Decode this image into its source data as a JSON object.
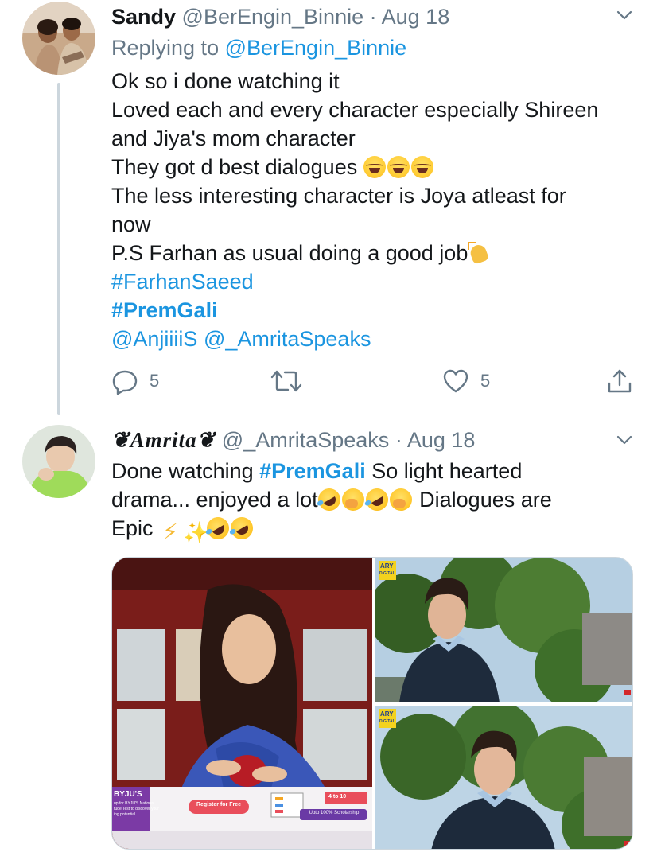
{
  "tweets": [
    {
      "name": "Sandy",
      "handle": "@BerEngin_Binnie",
      "separator": "·",
      "date": "Aug 18",
      "replying_prefix": "Replying to",
      "replying_handle": "@BerEngin_Binnie",
      "lines": {
        "l1": "Ok so i done watching it",
        "l2": "Loved each and every character especially Shireen",
        "l3": "and Jiya's mom character",
        "l4": "They got d best dialogues",
        "l5": "The less interesting character is Joya atleast for",
        "l6": "now",
        "l7": "P.S Farhan as usual doing a good job",
        "l8": "#FarhanSaeed",
        "l9": "#PremGali",
        "l10a": "@AnjiiiiS",
        "l10b": "@_AmritaSpeaks"
      },
      "reply_count": "5",
      "like_count": "5"
    },
    {
      "name": "❦Amrita❦",
      "handle": "@_AmritaSpeaks",
      "separator": "·",
      "date": "Aug 18",
      "text": {
        "a1": "Done watching ",
        "a2": "#PremGali",
        "a3": " So light hearted",
        "a4": "drama... enjoyed a lot",
        "a5": " Dialogues are",
        "a6": "Epic "
      },
      "media": {
        "ad_brand": "BYJU'S",
        "ad_line1": "up for BYJU'S National",
        "ad_line2": "tude Test to discover your",
        "ad_line3": "ing potential",
        "ad_cta": "Register for Free",
        "ad_badge": "Upto 100% Scholarship",
        "ad_grade": "4 to 10",
        "channel_logo_1": "ARY",
        "channel_sub_1": "DIGITAL",
        "channel_logo_2": "ARY",
        "channel_sub_2": "DIGITAL"
      }
    }
  ],
  "icons": {
    "caret": "chevron-down-icon",
    "reply": "reply-icon",
    "retweet": "retweet-icon",
    "like": "heart-icon",
    "share": "share-icon"
  },
  "colors": {
    "link": "#1b95e0",
    "muted": "#657786",
    "text": "#14171a",
    "thread_line": "#ccd6dd"
  }
}
